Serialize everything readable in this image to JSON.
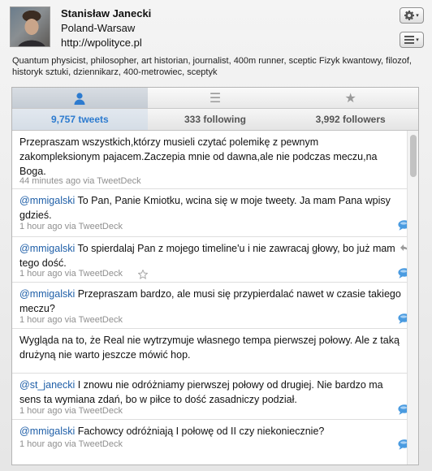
{
  "profile": {
    "name": "Stanisław Janecki",
    "location": "Poland-Warsaw",
    "url": "http://wpolityce.pl",
    "bio": "Quantum physicist, philosopher, art historian, journalist, 400m runner, sceptic  Fizyk kwantowy, filozof, historyk sztuki, dziennikarz, 400-metrowiec, sceptyk"
  },
  "toolbar": {
    "gear_icon": "gear-icon",
    "list_icon": "list-icon",
    "caret": "▾"
  },
  "tabs": [
    {
      "icon": "person-icon",
      "glyph": "",
      "active": true
    },
    {
      "icon": "list-icon",
      "glyph": "☰",
      "active": false
    },
    {
      "icon": "star-icon",
      "glyph": "★",
      "active": false
    }
  ],
  "stats": {
    "tweets": "9,757 tweets",
    "following": "333 following",
    "followers": "3,992 followers"
  },
  "tweets": [
    {
      "mention": "",
      "text": "Przepraszam wszystkich,którzy musieli czytać polemikę z pewnym zakompleksionym pajacem.Zaczepia mnie od dawna,ale nie podczas meczu,na Boga.",
      "meta": "44 minutes ago via TweetDeck"
    },
    {
      "mention": "@mmigalski",
      "text": " To Pan, Panie Kmiotku, wcina się w moje tweety. Ja mam Pana wpisy gdzieś.",
      "meta": "1 hour ago via TweetDeck"
    },
    {
      "mention": "@mmigalski",
      "text": " To spierdalaj Pan z mojego timeline'u i nie zawracaj głowy, bo już mam tego dość.",
      "meta": "1 hour ago via TweetDeck"
    },
    {
      "mention": "@mmigalski",
      "text": " Przepraszam bardzo, ale musi się przypierdalać nawet w czasie takiego meczu?",
      "meta": "1 hour ago via TweetDeck"
    },
    {
      "mention": "",
      "text": "Wygląda na to, że Real nie wytrzymuje własnego tempa pierwszej połowy. Ale z taką drużyną nie warto jeszcze mówić hop.",
      "meta": "1 hour ago via TweetDeck"
    },
    {
      "mention": "@st_janecki",
      "text": " I znowu nie odróżniamy pierwszej połowy od drugiej. Nie bardzo ma sens ta wymiana zdań, bo w piłce to dość zasadniczy podział.",
      "meta": "1 hour ago via TweetDeck"
    },
    {
      "mention": "@mmigalski",
      "text": " Fachowcy odróżniają I połowę od II czy niekoniecznie?",
      "meta": "1 hour ago via TweetDeck"
    }
  ],
  "colors": {
    "accent": "#2d7bcf",
    "mention": "#1f5fa8",
    "meta": "#8f8f8f",
    "reply_bubble": "#4a9be0"
  }
}
